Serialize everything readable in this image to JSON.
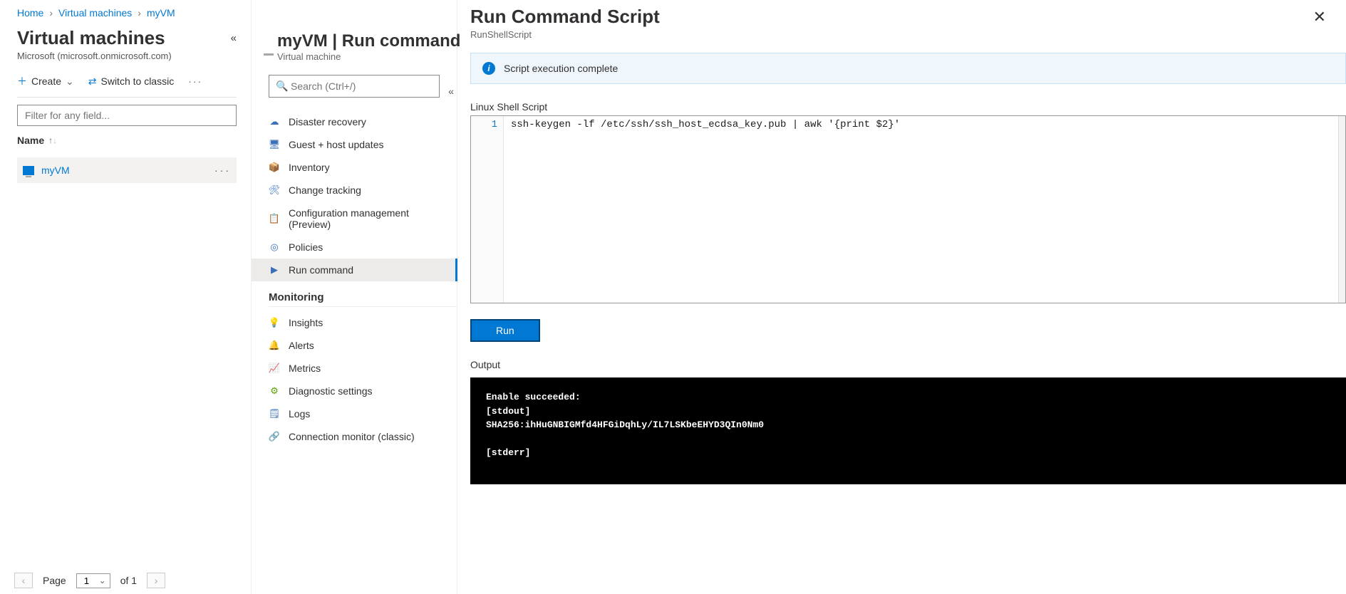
{
  "breadcrumb": {
    "home": "Home",
    "vmList": "Virtual machines",
    "vmName": "myVM"
  },
  "col1": {
    "title": "Virtual machines",
    "subtitle": "Microsoft (microsoft.onmicrosoft.com)",
    "toolbar": {
      "create": "Create",
      "switch": "Switch to classic"
    },
    "filterPlaceholder": "Filter for any field...",
    "nameHeader": "Name",
    "rows": [
      {
        "name": "myVM"
      }
    ],
    "pager": {
      "pageLabel": "Page",
      "page": "1",
      "of": "of 1"
    }
  },
  "col2": {
    "title": "myVM | Run command",
    "subtitle": "Virtual machine",
    "searchPlaceholder": "Search (Ctrl+/)",
    "section": "Monitoring",
    "menu": [
      {
        "icon": "☁",
        "label": "Disaster recovery"
      },
      {
        "icon": "🖥",
        "label": "Guest + host updates"
      },
      {
        "icon": "📦",
        "label": "Inventory"
      },
      {
        "icon": "🛠",
        "label": "Change tracking"
      },
      {
        "icon": "📋",
        "label": "Configuration management (Preview)"
      },
      {
        "icon": "◎",
        "label": "Policies"
      },
      {
        "icon": "▶",
        "label": "Run command",
        "selected": true
      }
    ],
    "monitoring": [
      {
        "icon": "💡",
        "label": "Insights"
      },
      {
        "icon": "🔔",
        "label": "Alerts"
      },
      {
        "icon": "📈",
        "label": "Metrics"
      },
      {
        "icon": "⚙",
        "label": "Diagnostic settings"
      },
      {
        "icon": "🗒",
        "label": "Logs"
      },
      {
        "icon": "🔗",
        "label": "Connection monitor (classic)"
      }
    ]
  },
  "panel": {
    "title": "Run Command Script",
    "subtitle": "RunShellScript",
    "statusText": "Script execution complete",
    "editorLabel": "Linux Shell Script",
    "lineNumber": "1",
    "code": "ssh-keygen -lf /etc/ssh/ssh_host_ecdsa_key.pub | awk '{print $2}'",
    "runLabel": "Run",
    "outputLabel": "Output",
    "output": "Enable succeeded:\n[stdout]\nSHA256:ihHuGNBIGMfd4HFGiDqhLy/IL7LSKbeEHYD3QIn0Nm0\n\n[stderr]"
  }
}
